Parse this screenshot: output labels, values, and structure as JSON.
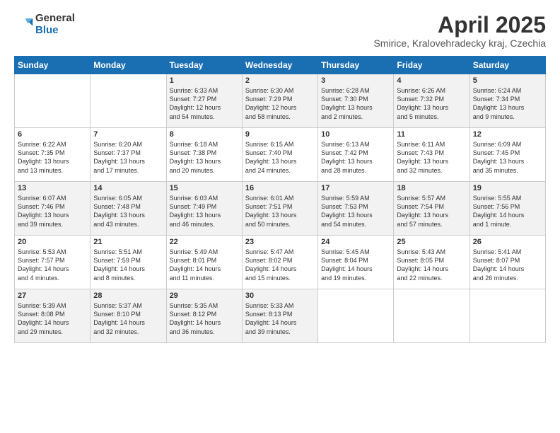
{
  "header": {
    "logo_general": "General",
    "logo_blue": "Blue",
    "month_title": "April 2025",
    "subtitle": "Smirice, Kralovehradecky kraj, Czechia"
  },
  "days_of_week": [
    "Sunday",
    "Monday",
    "Tuesday",
    "Wednesday",
    "Thursday",
    "Friday",
    "Saturday"
  ],
  "weeks": [
    [
      {
        "day": "",
        "info": ""
      },
      {
        "day": "",
        "info": ""
      },
      {
        "day": "1",
        "info": "Sunrise: 6:33 AM\nSunset: 7:27 PM\nDaylight: 12 hours\nand 54 minutes."
      },
      {
        "day": "2",
        "info": "Sunrise: 6:30 AM\nSunset: 7:29 PM\nDaylight: 12 hours\nand 58 minutes."
      },
      {
        "day": "3",
        "info": "Sunrise: 6:28 AM\nSunset: 7:30 PM\nDaylight: 13 hours\nand 2 minutes."
      },
      {
        "day": "4",
        "info": "Sunrise: 6:26 AM\nSunset: 7:32 PM\nDaylight: 13 hours\nand 5 minutes."
      },
      {
        "day": "5",
        "info": "Sunrise: 6:24 AM\nSunset: 7:34 PM\nDaylight: 13 hours\nand 9 minutes."
      }
    ],
    [
      {
        "day": "6",
        "info": "Sunrise: 6:22 AM\nSunset: 7:35 PM\nDaylight: 13 hours\nand 13 minutes."
      },
      {
        "day": "7",
        "info": "Sunrise: 6:20 AM\nSunset: 7:37 PM\nDaylight: 13 hours\nand 17 minutes."
      },
      {
        "day": "8",
        "info": "Sunrise: 6:18 AM\nSunset: 7:38 PM\nDaylight: 13 hours\nand 20 minutes."
      },
      {
        "day": "9",
        "info": "Sunrise: 6:15 AM\nSunset: 7:40 PM\nDaylight: 13 hours\nand 24 minutes."
      },
      {
        "day": "10",
        "info": "Sunrise: 6:13 AM\nSunset: 7:42 PM\nDaylight: 13 hours\nand 28 minutes."
      },
      {
        "day": "11",
        "info": "Sunrise: 6:11 AM\nSunset: 7:43 PM\nDaylight: 13 hours\nand 32 minutes."
      },
      {
        "day": "12",
        "info": "Sunrise: 6:09 AM\nSunset: 7:45 PM\nDaylight: 13 hours\nand 35 minutes."
      }
    ],
    [
      {
        "day": "13",
        "info": "Sunrise: 6:07 AM\nSunset: 7:46 PM\nDaylight: 13 hours\nand 39 minutes."
      },
      {
        "day": "14",
        "info": "Sunrise: 6:05 AM\nSunset: 7:48 PM\nDaylight: 13 hours\nand 43 minutes."
      },
      {
        "day": "15",
        "info": "Sunrise: 6:03 AM\nSunset: 7:49 PM\nDaylight: 13 hours\nand 46 minutes."
      },
      {
        "day": "16",
        "info": "Sunrise: 6:01 AM\nSunset: 7:51 PM\nDaylight: 13 hours\nand 50 minutes."
      },
      {
        "day": "17",
        "info": "Sunrise: 5:59 AM\nSunset: 7:53 PM\nDaylight: 13 hours\nand 54 minutes."
      },
      {
        "day": "18",
        "info": "Sunrise: 5:57 AM\nSunset: 7:54 PM\nDaylight: 13 hours\nand 57 minutes."
      },
      {
        "day": "19",
        "info": "Sunrise: 5:55 AM\nSunset: 7:56 PM\nDaylight: 14 hours\nand 1 minute."
      }
    ],
    [
      {
        "day": "20",
        "info": "Sunrise: 5:53 AM\nSunset: 7:57 PM\nDaylight: 14 hours\nand 4 minutes."
      },
      {
        "day": "21",
        "info": "Sunrise: 5:51 AM\nSunset: 7:59 PM\nDaylight: 14 hours\nand 8 minutes."
      },
      {
        "day": "22",
        "info": "Sunrise: 5:49 AM\nSunset: 8:01 PM\nDaylight: 14 hours\nand 11 minutes."
      },
      {
        "day": "23",
        "info": "Sunrise: 5:47 AM\nSunset: 8:02 PM\nDaylight: 14 hours\nand 15 minutes."
      },
      {
        "day": "24",
        "info": "Sunrise: 5:45 AM\nSunset: 8:04 PM\nDaylight: 14 hours\nand 19 minutes."
      },
      {
        "day": "25",
        "info": "Sunrise: 5:43 AM\nSunset: 8:05 PM\nDaylight: 14 hours\nand 22 minutes."
      },
      {
        "day": "26",
        "info": "Sunrise: 5:41 AM\nSunset: 8:07 PM\nDaylight: 14 hours\nand 26 minutes."
      }
    ],
    [
      {
        "day": "27",
        "info": "Sunrise: 5:39 AM\nSunset: 8:08 PM\nDaylight: 14 hours\nand 29 minutes."
      },
      {
        "day": "28",
        "info": "Sunrise: 5:37 AM\nSunset: 8:10 PM\nDaylight: 14 hours\nand 32 minutes."
      },
      {
        "day": "29",
        "info": "Sunrise: 5:35 AM\nSunset: 8:12 PM\nDaylight: 14 hours\nand 36 minutes."
      },
      {
        "day": "30",
        "info": "Sunrise: 5:33 AM\nSunset: 8:13 PM\nDaylight: 14 hours\nand 39 minutes."
      },
      {
        "day": "",
        "info": ""
      },
      {
        "day": "",
        "info": ""
      },
      {
        "day": "",
        "info": ""
      }
    ]
  ]
}
